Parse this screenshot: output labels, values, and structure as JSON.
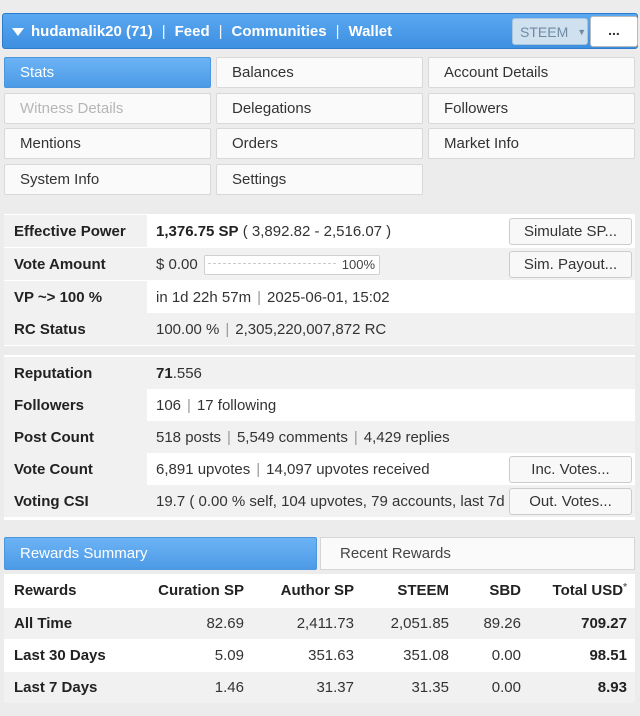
{
  "header": {
    "username": "hudamalik20 (71)",
    "nav": [
      "Feed",
      "Communities",
      "Wallet"
    ],
    "currency": "STEEM",
    "more_label": "..."
  },
  "menu": {
    "items": [
      {
        "label": "Stats",
        "state": "active"
      },
      {
        "label": "Balances",
        "state": "normal"
      },
      {
        "label": "Account Details",
        "state": "normal"
      },
      {
        "label": "Witness Details",
        "state": "disabled"
      },
      {
        "label": "Delegations",
        "state": "normal"
      },
      {
        "label": "Followers",
        "state": "normal"
      },
      {
        "label": "Mentions",
        "state": "normal"
      },
      {
        "label": "Orders",
        "state": "normal"
      },
      {
        "label": "Market Info",
        "state": "normal"
      },
      {
        "label": "System Info",
        "state": "normal"
      },
      {
        "label": "Settings",
        "state": "normal"
      }
    ]
  },
  "stats": {
    "effective_power": {
      "label": "Effective Power",
      "main": "1,376.75 SP",
      "detail": " ( 3,892.82 - 2,516.07 )",
      "button": "Simulate SP..."
    },
    "vote_amount": {
      "label": "Vote Amount",
      "value": "$ 0.00",
      "pct": "100%",
      "button": "Sim. Payout..."
    },
    "vp": {
      "label": "VP ~> 100 %",
      "value1": "in 1d 22h 57m",
      "value2": "2025-06-01, 15:02"
    },
    "rc": {
      "label": "RC Status",
      "value1": "100.00 %",
      "value2": "2,305,220,007,872 RC"
    }
  },
  "social": {
    "reputation": {
      "label": "Reputation",
      "int": "71",
      "frac": ".556"
    },
    "followers": {
      "label": "Followers",
      "value1": "106",
      "value2": "17 following"
    },
    "post_count": {
      "label": "Post Count",
      "value1": "518 posts",
      "value2": "5,549 comments",
      "value3": "4,429 replies"
    },
    "vote_count": {
      "label": "Vote Count",
      "value1": "6,891 upvotes",
      "value2": "14,097 upvotes received",
      "button": "Inc. Votes..."
    },
    "voting_csi": {
      "label": "Voting CSI",
      "value": "19.7 ( 0.00 % self, 104 upvotes, 79 accounts, last 7d )",
      "button": "Out. Votes..."
    }
  },
  "rewards": {
    "tabs": [
      "Rewards Summary",
      "Recent Rewards"
    ],
    "columns": [
      "Rewards",
      "Curation SP",
      "Author SP",
      "STEEM",
      "SBD",
      "Total USD"
    ],
    "footnote_mark": "*",
    "rows": [
      {
        "period": "All Time",
        "curation": "82.69",
        "author": "2,411.73",
        "steem": "2,051.85",
        "sbd": "89.26",
        "usd": "709.27"
      },
      {
        "period": "Last 30 Days",
        "curation": "5.09",
        "author": "351.63",
        "steem": "351.08",
        "sbd": "0.00",
        "usd": "98.51"
      },
      {
        "period": "Last 7 Days",
        "curation": "1.46",
        "author": "31.37",
        "steem": "31.35",
        "sbd": "0.00",
        "usd": "8.93"
      }
    ]
  }
}
